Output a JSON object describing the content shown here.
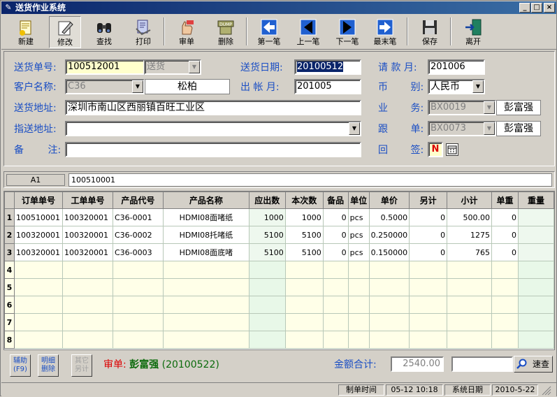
{
  "window": {
    "title": "送货作业系统"
  },
  "toolbar": {
    "new": "新建",
    "edit": "修改",
    "find": "查找",
    "print": "打印",
    "approve": "审单",
    "delete": "删除",
    "first": "第一笔",
    "prev": "上一笔",
    "next": "下一笔",
    "last": "最末笔",
    "save": "保存",
    "exit": "离开"
  },
  "form": {
    "delivery_no_label": "送货单号:",
    "delivery_no": "100512001",
    "delivery_type": "送货",
    "delivery_date_label": "送货日期:",
    "delivery_date": "20100512",
    "request_month_label": "请 款 月:",
    "request_month": "201006",
    "customer_label": "客户名称:",
    "customer_code": "C36",
    "customer_name": "松柏",
    "bill_month_label": "出 帐 月:",
    "bill_month": "201005",
    "currency_label": "币 别:",
    "currency": "人民币",
    "address_label": "送货地址:",
    "address": "深圳市南山区西丽镇百旺工业区",
    "sales_label": "业 务:",
    "sales_code": "BX0019",
    "sales_name": "彭富强",
    "dest_label": "指送地址:",
    "dest": "",
    "follow_label": "跟 单:",
    "follow_code": "BX0073",
    "follow_name": "彭富强",
    "remark_label": "备 注:",
    "remark": "",
    "receipt_label": "回 签:",
    "receipt_value": "N"
  },
  "cellbar": {
    "ref": "A1",
    "value": "100510001"
  },
  "grid": {
    "columns": [
      "订单单号",
      "工单单号",
      "产品代号",
      "产品名称",
      "应出数",
      "本次数",
      "备品",
      "单位",
      "单价",
      "另计",
      "小计",
      "单重",
      "重量"
    ],
    "rows": [
      {
        "n": "1",
        "order": "100510001",
        "work": "100320001",
        "code": "C36-0001",
        "name": "HDMI08面啫纸",
        "due": "1000",
        "qty": "1000",
        "spare": "0",
        "unit": "pcs",
        "price": "0.5000",
        "extra": "0",
        "subtotal": "500.00",
        "unitwt": "0",
        "weight": ""
      },
      {
        "n": "2",
        "order": "100320001",
        "work": "100320001",
        "code": "C36-0002",
        "name": "HDMI08托啫纸",
        "due": "5100",
        "qty": "5100",
        "spare": "0",
        "unit": "pcs",
        "price": "0.250000",
        "extra": "0",
        "subtotal": "1275",
        "unitwt": "0",
        "weight": ""
      },
      {
        "n": "3",
        "order": "100320001",
        "work": "100320001",
        "code": "C36-0003",
        "name": "HDMI08面底啫",
        "due": "5100",
        "qty": "5100",
        "spare": "0",
        "unit": "pcs",
        "price": "0.150000",
        "extra": "0",
        "subtotal": "765",
        "unitwt": "0",
        "weight": ""
      }
    ],
    "empty_rows": [
      "4",
      "5",
      "6",
      "7",
      "8"
    ]
  },
  "bottom": {
    "aux_btn": "辅助(F9)",
    "detail_delete_btn": "明细删除",
    "other_btn": "其它另计",
    "approve_label": "审单:",
    "approver": "彭富强",
    "approve_date": "(20100522)",
    "amount_label": "金额合计:",
    "amount": "2540.00",
    "quick_btn": "速查"
  },
  "status": {
    "make_time_label": "制单时间",
    "make_time": "05-12 10:18",
    "sys_date_label": "系统日期",
    "sys_date": "2010-5-22"
  }
}
